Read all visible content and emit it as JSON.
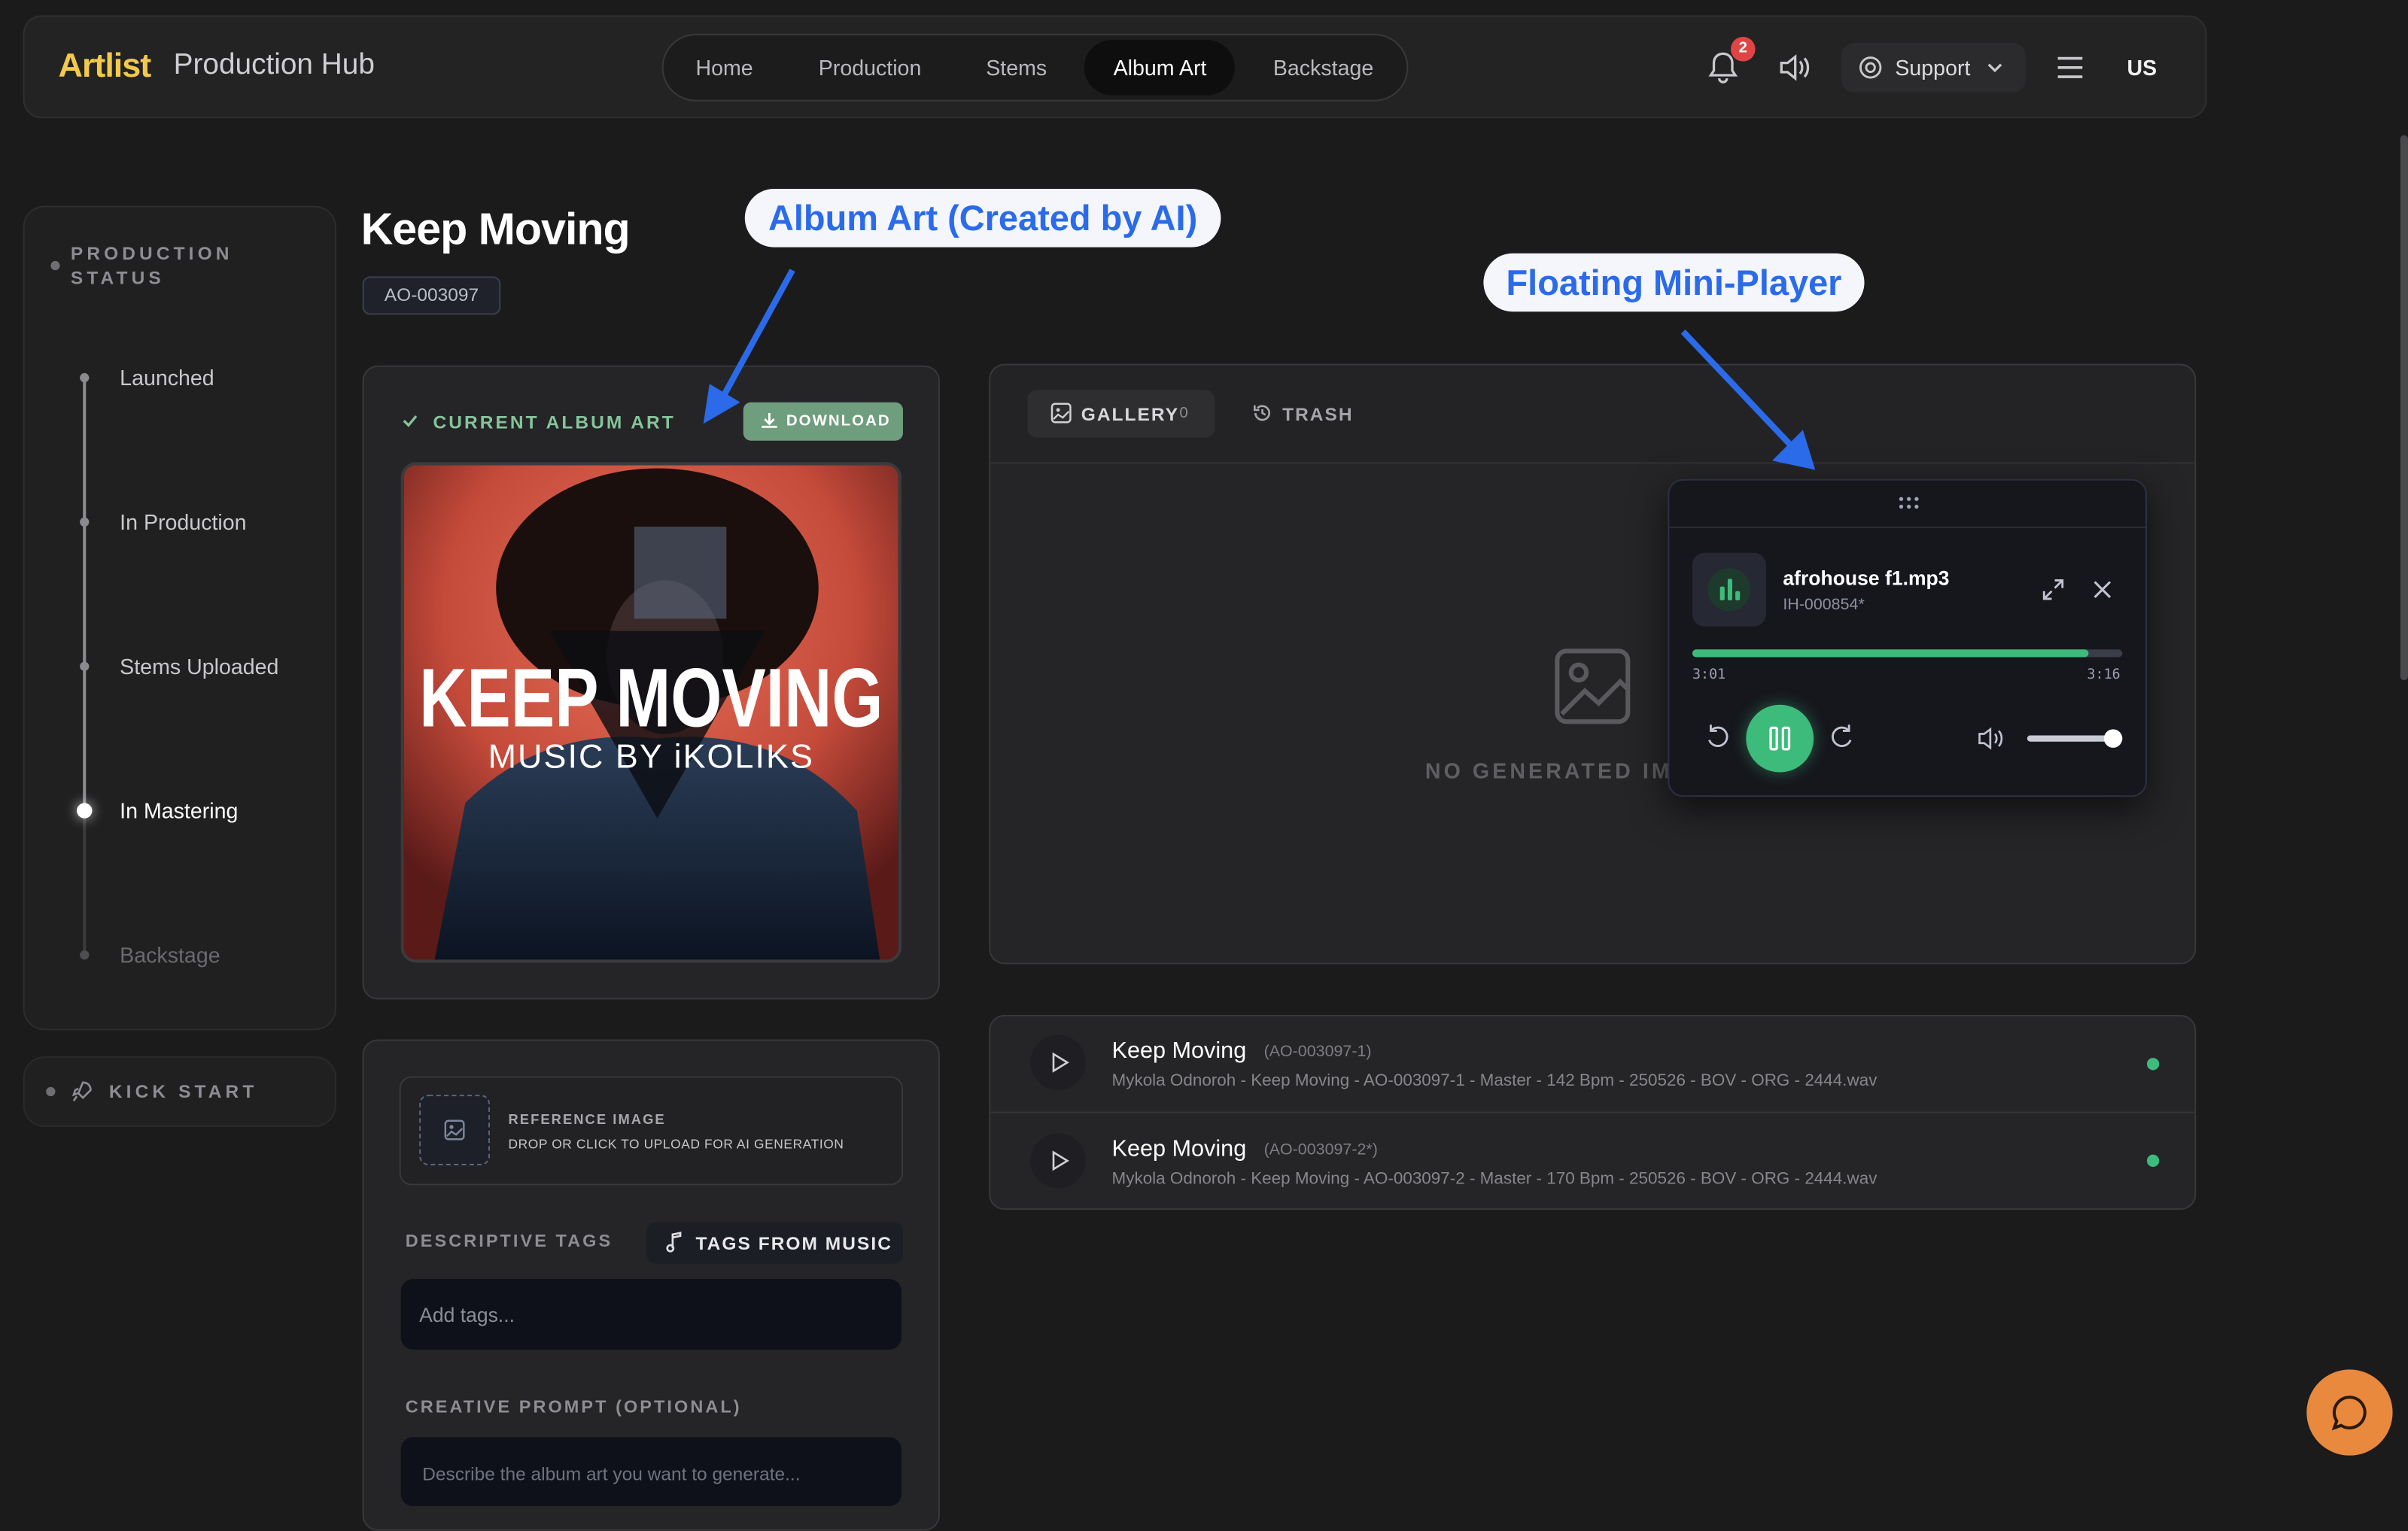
{
  "header": {
    "logo": "Artlist",
    "app_title": "Production Hub",
    "nav": [
      "Home",
      "Production",
      "Stems",
      "Album Art",
      "Backstage"
    ],
    "active_nav": "Album Art",
    "notification_count": "2",
    "support_label": "Support",
    "region": "US"
  },
  "sidebar": {
    "status_title_line1": "PRODUCTION",
    "status_title_line2": "STATUS",
    "steps": [
      "Launched",
      "In Production",
      "Stems Uploaded",
      "In Mastering",
      "Backstage"
    ],
    "current_step": "In Mastering",
    "kick_start": "KICK START"
  },
  "page": {
    "title": "Keep Moving",
    "code": "AO-003097"
  },
  "album_art": {
    "label": "CURRENT ALBUM ART",
    "download": "DOWNLOAD",
    "cover_title": "KEEP MOVING",
    "cover_subtitle": "MUSIC BY iKOLIKS"
  },
  "generator": {
    "reference_title": "REFERENCE IMAGE",
    "reference_hint": "DROP OR CLICK TO UPLOAD FOR AI GENERATION",
    "tags_label": "DESCRIPTIVE TAGS",
    "tags_button": "TAGS FROM MUSIC",
    "tags_placeholder": "Add tags...",
    "prompt_label": "CREATIVE PROMPT (OPTIONAL)",
    "prompt_placeholder": "Describe the album art you want to generate..."
  },
  "gallery": {
    "tab_gallery": "GALLERY",
    "gallery_count": "0",
    "tab_trash": "TRASH",
    "empty_text": "NO GENERATED IMAG"
  },
  "player": {
    "file": "afrohouse f1.mp3",
    "code": "IH-000854*",
    "elapsed": "3:01",
    "duration": "3:16",
    "progress": 0.92,
    "volume": 0.9
  },
  "tracks": [
    {
      "title": "Keep Moving",
      "code": "(AO-003097-1)",
      "file": "Mykola Odnoroh - Keep Moving - AO-003097-1 - Master - 142 Bpm - 250526 - BOV - ORG - 2444.wav"
    },
    {
      "title": "Keep Moving",
      "code": "(AO-003097-2*)",
      "file": "Mykola Odnoroh - Keep Moving - AO-003097-2 - Master - 170 Bpm - 250526 - BOV - ORG - 2444.wav"
    }
  ],
  "annotations": {
    "album_art": "Album Art (Created by AI)",
    "mini_player": "Floating Mini-Player"
  },
  "colors": {
    "accent_green": "#3dbb7a",
    "brand_yellow": "#f2c94c",
    "callout_blue": "#2b6bea"
  }
}
